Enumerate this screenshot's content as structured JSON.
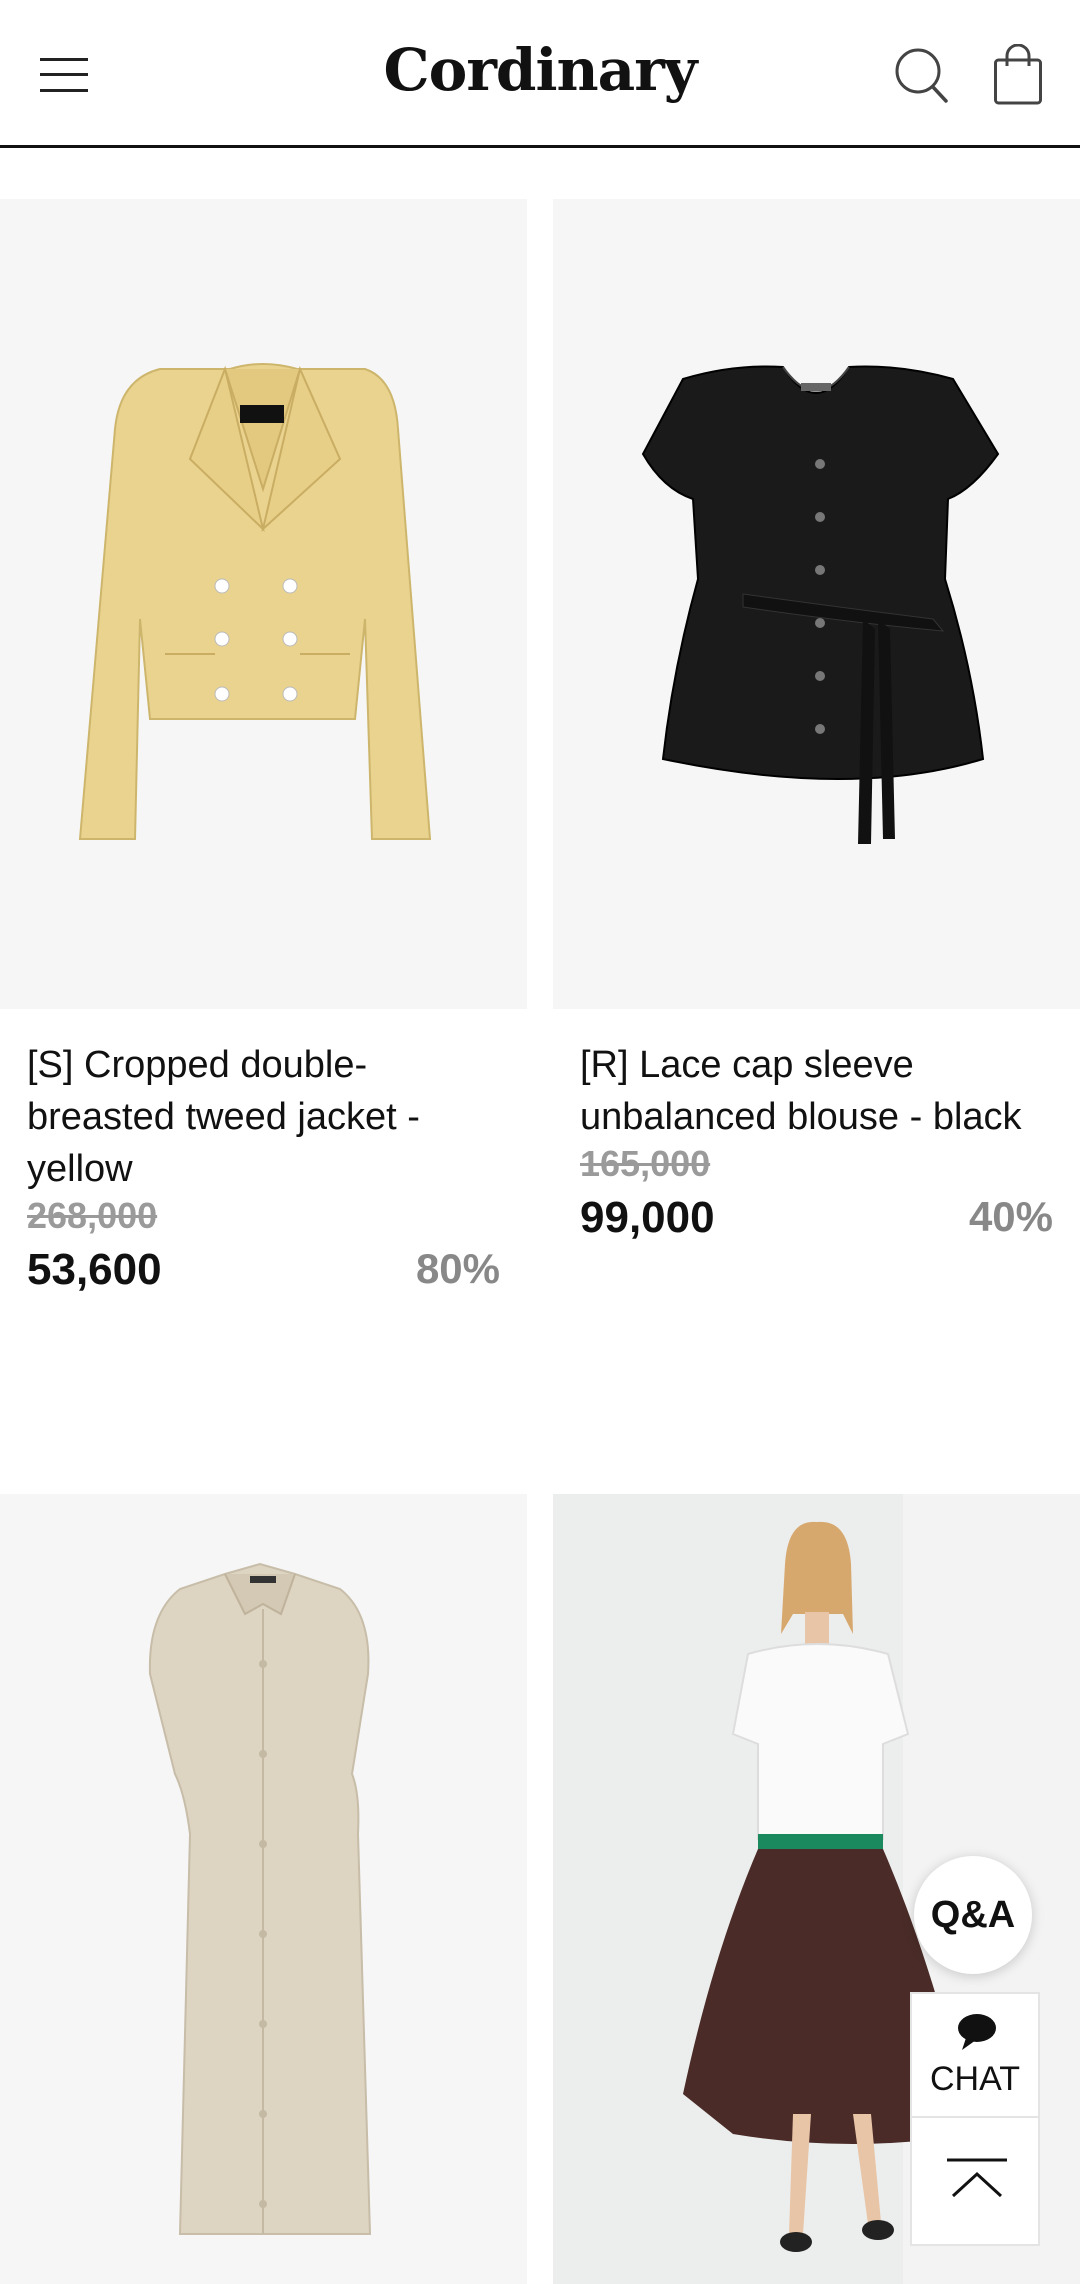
{
  "header": {
    "logo": "Cordinary"
  },
  "products": [
    {
      "name": "[S] Cropped double-breasted tweed jacket - yellow",
      "original_price": "268,000",
      "sale_price": "53,600",
      "discount": "80%"
    },
    {
      "name": "[R] Lace cap sleeve unbalanced blouse - black",
      "original_price": "165,000",
      "sale_price": "99,000",
      "discount": "40%"
    },
    {
      "name": "",
      "original_price": "",
      "sale_price": "",
      "discount": ""
    },
    {
      "name": "",
      "original_price": "",
      "sale_price": "",
      "discount": ""
    }
  ],
  "floating": {
    "qa_label": "Q&A",
    "chat_label": "CHAT"
  },
  "icons": [
    "menu-icon",
    "search-icon",
    "shopping-bag-icon",
    "chat-bubble-icon",
    "arrow-up-icon"
  ]
}
